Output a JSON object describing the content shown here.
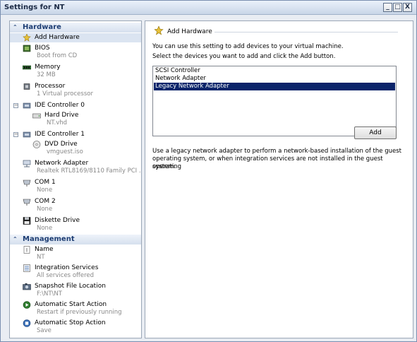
{
  "window": {
    "title": "Settings for NT",
    "controls": [
      "_",
      "□",
      "X"
    ]
  },
  "sidebar": {
    "hardware_header": "Hardware",
    "management_header": "Management",
    "hardware_items": [
      {
        "name": "Add Hardware",
        "sub": ""
      },
      {
        "name": "BIOS",
        "sub": "Boot from CD"
      },
      {
        "name": "Memory",
        "sub": "32 MB"
      },
      {
        "name": "Processor",
        "sub": "1 Virtual processor"
      },
      {
        "name": "IDE Controller 0",
        "sub": ""
      },
      {
        "name": "Hard Drive",
        "sub": "NT.vhd"
      },
      {
        "name": "IDE Controller 1",
        "sub": ""
      },
      {
        "name": "DVD Drive",
        "sub": "vmguest.iso"
      },
      {
        "name": "Network Adapter",
        "sub": "Realtek RTL8169/8110 Family PCI ..."
      },
      {
        "name": "COM 1",
        "sub": "None"
      },
      {
        "name": "COM 2",
        "sub": "None"
      },
      {
        "name": "Diskette Drive",
        "sub": "None"
      }
    ],
    "management_items": [
      {
        "name": "Name",
        "sub": "NT"
      },
      {
        "name": "Integration Services",
        "sub": "All services offered"
      },
      {
        "name": "Snapshot File Location",
        "sub": "F:\\NT\\NT"
      },
      {
        "name": "Automatic Start Action",
        "sub": "Restart if previously running"
      },
      {
        "name": "Automatic Stop Action",
        "sub": "Save"
      }
    ]
  },
  "main": {
    "group_title": "Add Hardware",
    "intro": "You can use this setting to add devices to your virtual machine.",
    "instruction": "Select the devices you want to add and click the Add button.",
    "devices": [
      "SCSI Controller",
      "Network Adapter",
      "Legacy Network Adapter"
    ],
    "selected_device": "Legacy Network Adapter",
    "add_button": "Add",
    "description_line1": "Use a legacy network adapter to perform a network-based installation of the guest",
    "description_line2": "operating system, or when integration services are not installed in the guest operating",
    "description_line3": "system."
  }
}
